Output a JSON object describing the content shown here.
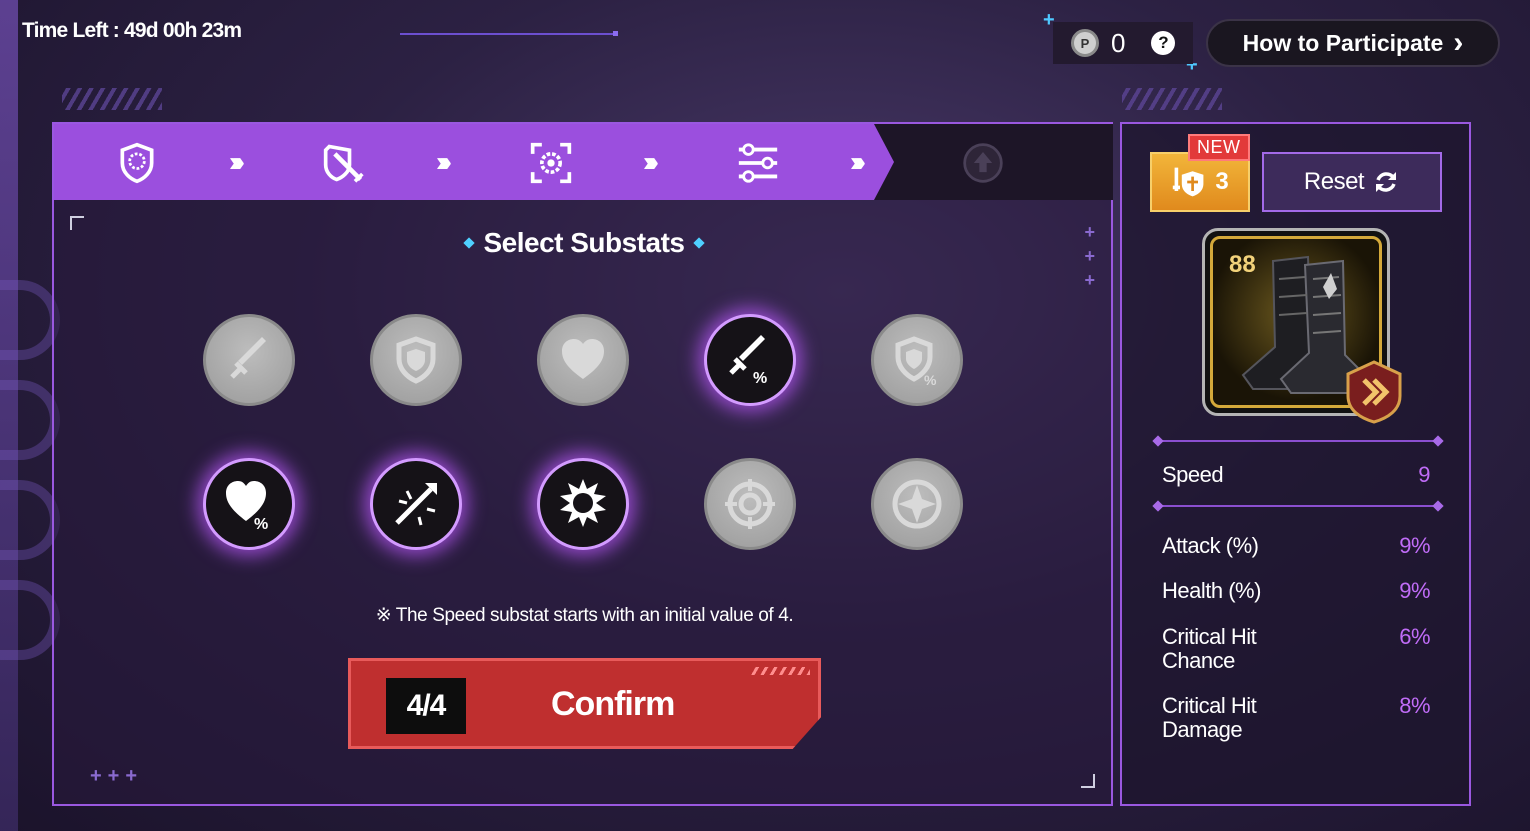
{
  "header": {
    "time_left": "Time Left : 49d 00h 23m",
    "coin_count": "0",
    "help": "?",
    "howto_label": "How to Participate",
    "howto_arrow": "›"
  },
  "steps": [
    {
      "icon": "shield-badge-icon",
      "state": "done"
    },
    {
      "icon": "shield-sword-icon",
      "state": "done"
    },
    {
      "icon": "target-frame-icon",
      "state": "done"
    },
    {
      "icon": "sliders-icon",
      "state": "current"
    },
    {
      "icon": "upgrade-icon",
      "state": "locked"
    }
  ],
  "main": {
    "title": "Select Substats",
    "note": "※ The Speed substat starts with an initial value of 4.",
    "confirm_count": "4/4",
    "confirm_label": "Confirm"
  },
  "substats": [
    {
      "icon": "attack-flat-icon",
      "selected": false
    },
    {
      "icon": "defense-flat-icon",
      "selected": false
    },
    {
      "icon": "health-flat-icon",
      "selected": false
    },
    {
      "icon": "attack-percent-icon",
      "selected": true
    },
    {
      "icon": "defense-percent-icon",
      "selected": false
    },
    {
      "icon": "health-percent-icon",
      "selected": true
    },
    {
      "icon": "critical-chance-icon",
      "selected": true
    },
    {
      "icon": "critical-damage-icon",
      "selected": true
    },
    {
      "icon": "effectiveness-icon",
      "selected": false
    },
    {
      "icon": "effect-resistance-icon",
      "selected": false
    }
  ],
  "side": {
    "badge_new": "NEW",
    "badge_count": "3",
    "reset_label": "Reset",
    "item_level": "88",
    "stats": [
      {
        "label": "Speed",
        "value": "9"
      },
      {
        "label": "Attack (%)",
        "value": "9%"
      },
      {
        "label": "Health (%)",
        "value": "9%"
      },
      {
        "label": "Critical Hit",
        "label2": "Chance",
        "value": "6%"
      },
      {
        "label": "Critical Hit",
        "label2": "Damage",
        "value": "8%"
      }
    ]
  },
  "colors": {
    "accent_purple": "#9b4fde",
    "confirm_red": "#bf2f2f",
    "value_purple": "#c06cf7",
    "badge_orange": "#e08a1d"
  }
}
